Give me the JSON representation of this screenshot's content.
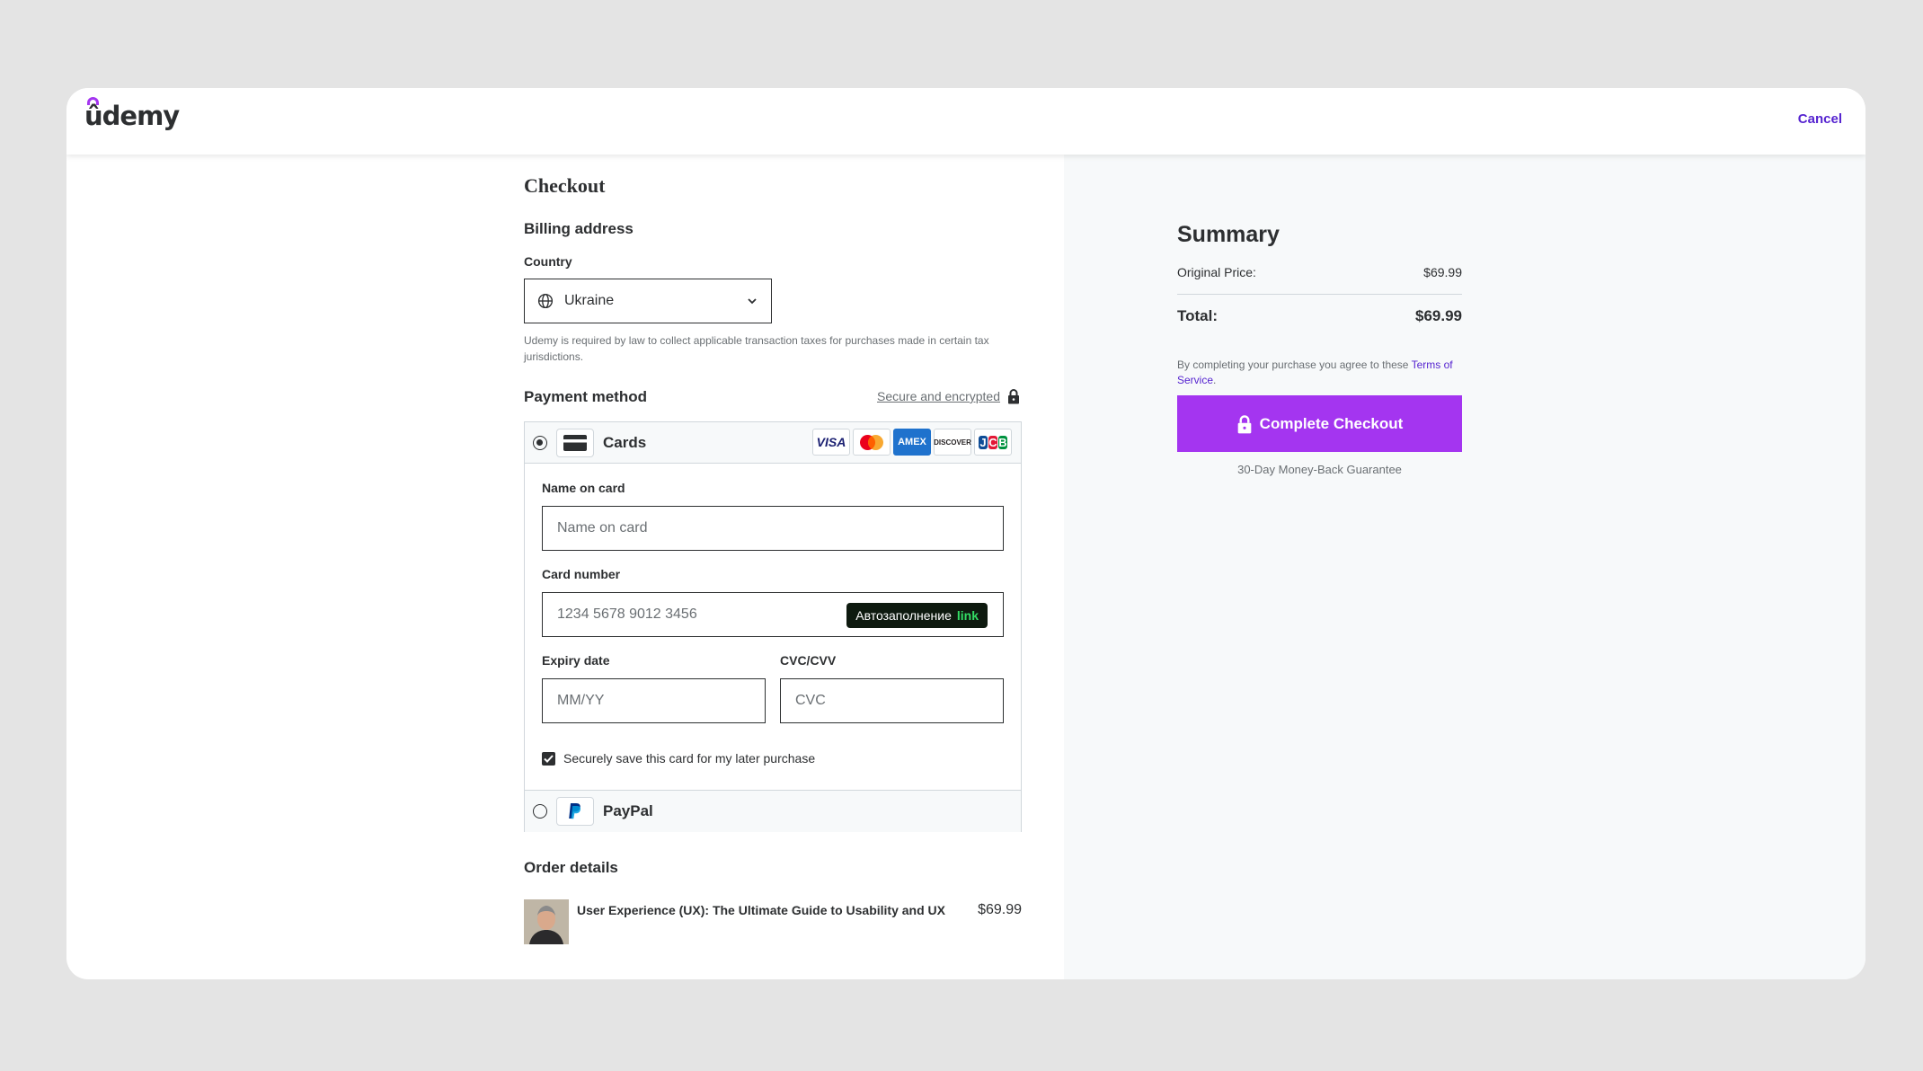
{
  "header": {
    "logo_text": "ûdemy",
    "cancel_label": "Cancel"
  },
  "checkout": {
    "title": "Checkout",
    "billing": {
      "title": "Billing address",
      "country_label": "Country",
      "country_value": "Ukraine",
      "tax_note": "Udemy is required by law to collect applicable transaction taxes for purchases made in certain tax jurisdictions."
    },
    "payment": {
      "title": "Payment method",
      "secure_text": "Secure and encrypted",
      "cards_label": "Cards",
      "card_brands": [
        "VISA",
        "Mastercard",
        "AMEX",
        "DISCOVER",
        "JCB"
      ],
      "name_label": "Name on card",
      "name_placeholder": "Name on card",
      "number_label": "Card number",
      "number_placeholder": "1234 5678 9012 3456",
      "autofill_text": "Автозаполнение",
      "autofill_brand": "link",
      "expiry_label": "Expiry date",
      "expiry_placeholder": "MM/YY",
      "cvc_label": "CVC/CVV",
      "cvc_placeholder": "CVC",
      "save_card_label": "Securely save this card for my later purchase",
      "save_card_checked": true,
      "paypal_label": "PayPal",
      "selected_method": "Cards"
    },
    "order": {
      "title": "Order details",
      "items": [
        {
          "name": "User Experience (UX): The Ultimate Guide to Usability and UX",
          "price": "$69.99"
        }
      ]
    }
  },
  "summary": {
    "title": "Summary",
    "original_price_label": "Original Price:",
    "original_price_value": "$69.99",
    "total_label": "Total:",
    "total_value": "$69.99",
    "terms_prefix": "By completing your purchase you agree to these",
    "terms_link": "Terms of Service",
    "terms_suffix": ".",
    "cta_label": "Complete Checkout",
    "guarantee": "30-Day Money-Back Guarantee"
  },
  "colors": {
    "accent": "#a435f0",
    "link": "#5624d0",
    "text": "#2d2f31",
    "muted": "#6a6f73",
    "panel_bg": "#f7f9fa",
    "page_bg": "#e4e4e4"
  }
}
